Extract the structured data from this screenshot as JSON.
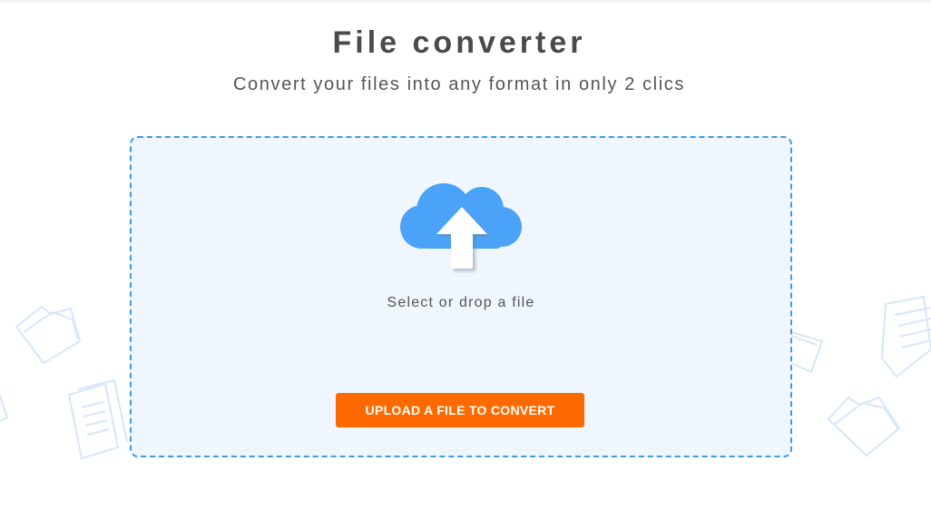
{
  "header": {
    "title": "File converter",
    "subtitle": "Convert your files into any format in only 2 clics"
  },
  "dropzone": {
    "icon": "cloud-upload-icon",
    "label": "Select or drop a file",
    "button_label": "UPLOAD A FILE TO CONVERT"
  },
  "colors": {
    "accent": "#ff6a00",
    "dropzone_border": "#3d9be9",
    "dropzone_bg": "#f0f6fd",
    "cloud": "#4aa3f8",
    "text": "#4a4a4a"
  },
  "decorations": [
    "folder-icon",
    "documents-icon"
  ]
}
